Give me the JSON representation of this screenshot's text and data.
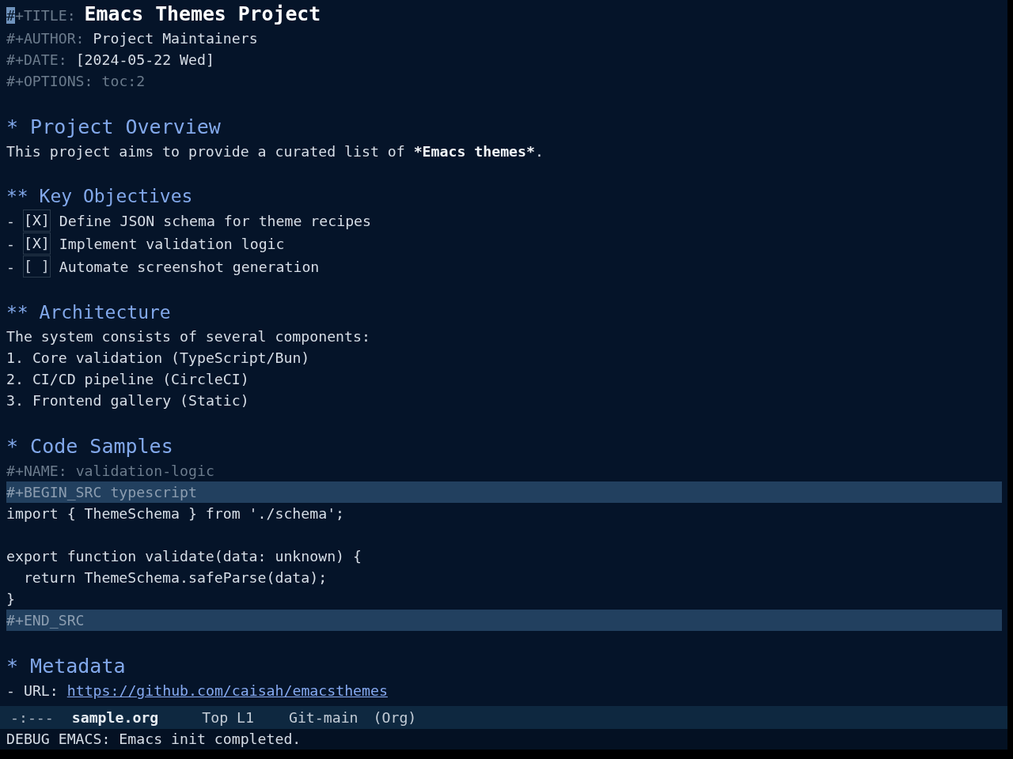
{
  "buffer": {
    "header": [
      {
        "kind": "title",
        "keyword": "#+TITLE:",
        "value": "Emacs Themes Project",
        "cursor": true
      },
      {
        "kind": "text",
        "keyword": "#+AUTHOR:",
        "value": "Project Maintainers",
        "cursor": false
      },
      {
        "kind": "text",
        "keyword": "#+DATE:",
        "value": "[2024-05-22 Wed]",
        "cursor": false
      },
      {
        "kind": "meta",
        "keyword": "#+OPTIONS:",
        "value": "toc:2",
        "cursor": false
      }
    ],
    "outline": [
      {
        "heading": "* Project Overview",
        "body": [
          {
            "kind": "paragraph",
            "segments": [
              {
                "text": "This project aims to provide a curated list of ",
                "bold": false
              },
              {
                "text": "*Emacs themes*",
                "bold": true
              },
              {
                "text": ".",
                "bold": false
              }
            ]
          }
        ],
        "children": [
          {
            "heading": "** Key Objectives",
            "body": [
              {
                "kind": "checkbox",
                "bullet": "-",
                "box": "[X]",
                "checked": true,
                "text": "Define JSON schema for theme recipes"
              },
              {
                "kind": "checkbox",
                "bullet": "-",
                "box": "[X]",
                "checked": true,
                "text": "Implement validation logic"
              },
              {
                "kind": "checkbox",
                "bullet": "-",
                "box": "[ ]",
                "checked": false,
                "text": "Automate screenshot generation"
              }
            ]
          },
          {
            "heading": "** Architecture",
            "body": [
              {
                "kind": "paragraph",
                "segments": [
                  {
                    "text": "The system consists of several components:",
                    "bold": false
                  }
                ]
              },
              {
                "kind": "numbered",
                "number": "1.",
                "text": "Core validation (TypeScript/Bun)"
              },
              {
                "kind": "numbered",
                "number": "2.",
                "text": "CI/CD pipeline (CircleCI)"
              },
              {
                "kind": "numbered",
                "number": "3.",
                "text": "Frontend gallery (Static)"
              }
            ]
          }
        ]
      },
      {
        "heading": "* Code Samples",
        "body": [
          {
            "kind": "keyword",
            "keyword": "#+NAME:",
            "value": "validation-logic"
          },
          {
            "kind": "src",
            "begin": "#+BEGIN_SRC typescript",
            "code": "import { ThemeSchema } from './schema';\n\nexport function validate(data: unknown) {\n  return ThemeSchema.safeParse(data);\n}",
            "end": "#+END_SRC"
          }
        ]
      },
      {
        "heading": "* Metadata",
        "body": [
          {
            "kind": "link",
            "bullet": "-",
            "label": "URL:",
            "url": "https://github.com/caisah/emacsthemes"
          }
        ]
      }
    ]
  },
  "mode_line": {
    "status": "-:---",
    "buffer_name": "sample.org",
    "position": "Top L1",
    "vc": "Git-main",
    "mode": "(Org)"
  },
  "echo_area": {
    "message": "DEBUG EMACS: Emacs init completed."
  }
}
